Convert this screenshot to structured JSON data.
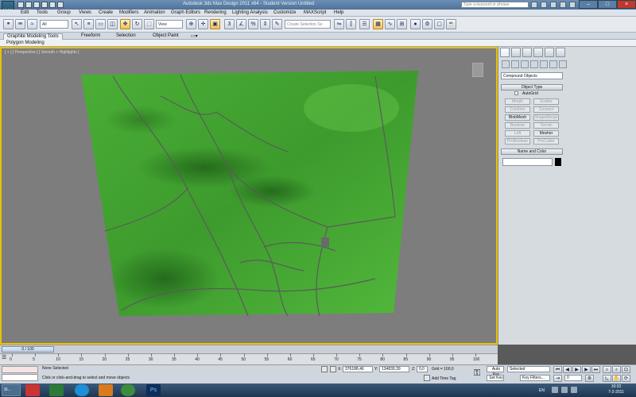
{
  "window": {
    "title": "Autodesk 3ds Max Design 2011 x64 - Student Version   Untitled",
    "search_placeholder": "Type a keyword or phrase",
    "logo_text": "MAX"
  },
  "menu": [
    "Edit",
    "Tools",
    "Group",
    "Views",
    "Create",
    "Modifiers",
    "Animation",
    "Graph Editors",
    "Rendering",
    "Lighting Analysis",
    "Customize",
    "MAXScript",
    "Help"
  ],
  "toolbar": {
    "selection_filter": "All",
    "reference_coord": "View",
    "named_selection_placeholder": "Create Selection Se"
  },
  "ribbon": {
    "tabs": [
      "Graphite Modeling Tools",
      "Freeform",
      "Selection",
      "Object Paint"
    ],
    "subtab": "Polygon Modeling"
  },
  "viewport": {
    "label": "[ + ] [ Perspective ] [ Smooth + Highlights ]",
    "terrain_color": "#3a9a2c"
  },
  "timeline": {
    "slider_text": "0 / 100",
    "ticks": [
      "0",
      "5",
      "10",
      "15",
      "20",
      "25",
      "30",
      "35",
      "40",
      "45",
      "50",
      "55",
      "60",
      "65",
      "70",
      "75",
      "80",
      "85",
      "90",
      "95",
      "100"
    ]
  },
  "command_panel": {
    "category": "Compound Objects",
    "object_type_title": "Object Type",
    "autogrid": "AutoGrid",
    "buttons": [
      {
        "label": "Morph",
        "enabled": false
      },
      {
        "label": "Scatter",
        "enabled": false
      },
      {
        "label": "Conform",
        "enabled": false
      },
      {
        "label": "Connect",
        "enabled": false
      },
      {
        "label": "BlobMesh",
        "enabled": true
      },
      {
        "label": "ShapeMerge",
        "enabled": false
      },
      {
        "label": "Boolean",
        "enabled": false
      },
      {
        "label": "Terrain",
        "enabled": false
      },
      {
        "label": "Loft",
        "enabled": false
      },
      {
        "label": "Mesher",
        "enabled": true
      },
      {
        "label": "ProBoolean",
        "enabled": false
      },
      {
        "label": "ProCutter",
        "enabled": false
      }
    ],
    "name_color_title": "Name and Color"
  },
  "status": {
    "selection": "None Selected",
    "prompt": "Click or click-and-drag to select and move objects",
    "x_label": "X:",
    "x_value": "376188,46",
    "y_label": "Y:",
    "y_value": "134839,39",
    "z_label": "Z:",
    "z_value": "0,0",
    "grid": "Grid = 100,0",
    "add_time_tag": "Add Time Tag",
    "auto_key": "Auto Key",
    "set_key": "Set Key",
    "key_mode": "Selected",
    "key_filters": "Key Filters...",
    "frame": "0"
  },
  "taskbar": {
    "lang": "EN",
    "time": "10:32",
    "date": "7-2-2011",
    "active_task": "Sl..."
  }
}
